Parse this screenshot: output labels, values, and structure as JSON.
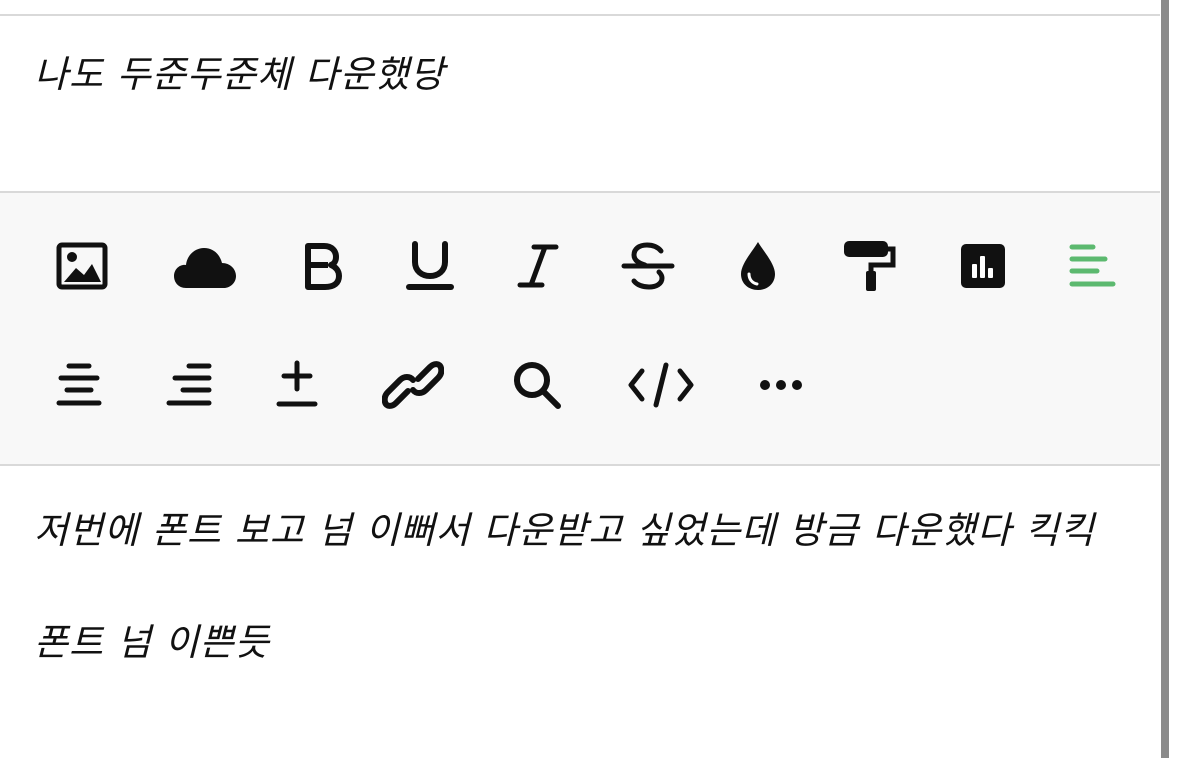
{
  "post_top": {
    "text": "나도 두준두준체 다운했당"
  },
  "post_bottom": {
    "line1": "저번에 폰트 보고 넘 이뻐서 다운받고 싶었는데 방금 다운했다 킥킥",
    "line2": "폰트 넘 이쁜듯"
  },
  "toolbar": {
    "icons": [
      "image-icon",
      "cloud-icon",
      "bold-icon",
      "underline-icon",
      "italic-icon",
      "strikethrough-icon",
      "color-drop-icon",
      "paint-roller-icon",
      "chart-icon",
      "align-left-icon",
      "align-center-icon",
      "align-right-icon",
      "plus-minus-icon",
      "link-icon",
      "search-icon",
      "code-icon",
      "more-icon"
    ],
    "active_color": "#5cb96f",
    "icon_color": "#111111"
  }
}
